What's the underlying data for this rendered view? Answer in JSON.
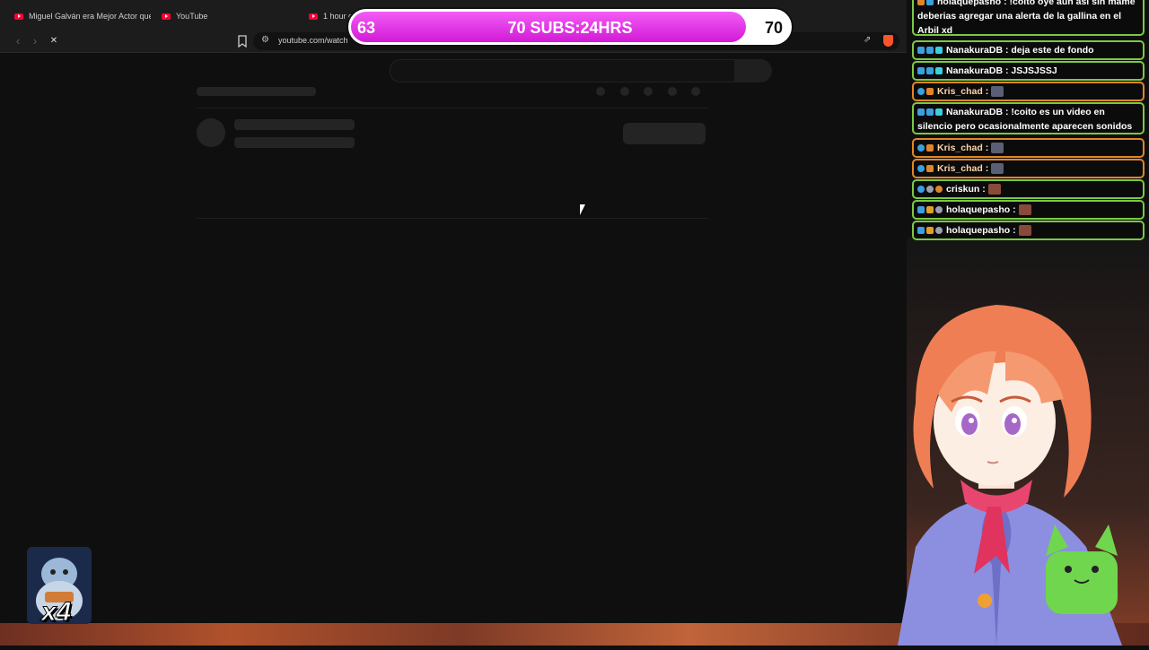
{
  "browser": {
    "tabs": [
      {
        "label": "Miguel Galván era Mejor Actor que C"
      },
      {
        "label": "YouTube"
      },
      {
        "label": "1 hour c"
      }
    ],
    "nav": {
      "back": "‹",
      "forward": "›",
      "reload": "✕"
    },
    "url": "youtube.com/watch"
  },
  "subgoal": {
    "start": "63",
    "title": "70 SUBS:24HRS",
    "end": "70",
    "progress": 0.9,
    "color": "#d21ad6"
  },
  "chat": {
    "messages": [
      {
        "user": "holaquepasho",
        "text": "!coito oye aun asi sin mame deberias agregar una alerta de la gallina en el Arbil xd",
        "border": "#7ac943"
      },
      {
        "user": "NanakuraDB",
        "text": "deja este de fondo",
        "border": "#7ac943"
      },
      {
        "user": "NanakuraDB",
        "text": "JSJSJSSJ",
        "border": "#7ac943"
      },
      {
        "user": "Kris_chad",
        "text": "",
        "border": "#e0862a"
      },
      {
        "user": "NanakuraDB",
        "text": "!coito es un video en silencio pero ocasionalmente aparecen sonidos",
        "border": "#7ac943"
      },
      {
        "user": "Kris_chad",
        "text": "",
        "border": "#e0862a"
      },
      {
        "user": "Kris_chad",
        "text": "",
        "border": "#e0862a"
      },
      {
        "user": "criskun",
        "text": "",
        "border": "#7ac943"
      },
      {
        "user": "holaquepasho",
        "text": "",
        "border": "#7ac943"
      },
      {
        "user": "holaquepasho",
        "text": "",
        "border": "#7ac943"
      }
    ],
    "separator": ":"
  },
  "sticker": {
    "multiplier": "x4"
  },
  "icons": {
    "bookmark": "bookmark-icon",
    "site-info": "site-info-icon",
    "share": "share-icon",
    "brave": "brave-shield-icon"
  }
}
